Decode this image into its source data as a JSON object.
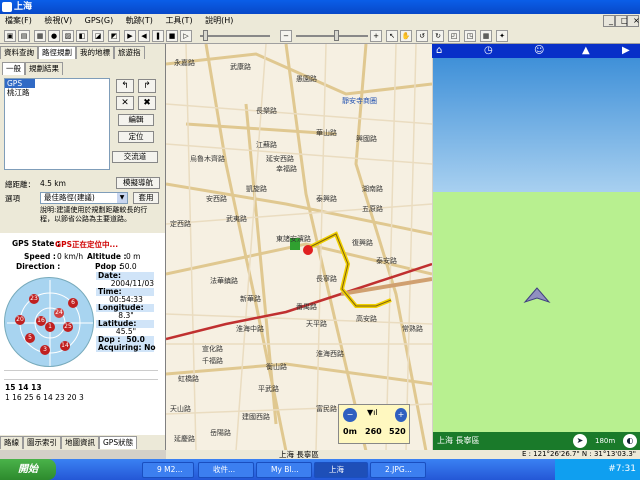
{
  "window": {
    "title": "上海"
  },
  "menu": [
    "檔案(F)",
    "檢視(V)",
    "GPS(G)",
    "軌跡(T)",
    "工具(T)",
    "說明(H)"
  ],
  "left_tabs": [
    "資料查詢",
    "路徑規劃",
    "我的地標",
    "旅遊指"
  ],
  "sub_tabs": [
    "一般",
    "規劃結果"
  ],
  "route_list": [
    "GPS",
    "桃江路"
  ],
  "buttons": {
    "edit": "編輯",
    "locate": "定位",
    "swap": "交流道",
    "simulate": "模擬導航",
    "apply": "套用"
  },
  "route_info": {
    "distance_label": "總距離：",
    "distance_value": "4.5 km",
    "option_label": "選項",
    "option_value": "最佳路徑(建議)"
  },
  "note": "說明:建議使用於規劃距離較長的行程，以節省公路為主要道路。",
  "gps": {
    "state_label": "GPS State :",
    "state_value": "GPS正在定位中...",
    "speed_label": "Speed :",
    "speed_value": "0 km/h",
    "altitude_label": "Altitude :",
    "altitude_value": "0 m",
    "direction_label": "Direction :",
    "pdop_label": "Pdop :",
    "pdop_value": "50.0",
    "date_label": "Date:",
    "date_value": "2004/11/03",
    "time_label": "Time:",
    "time_value": "00:54:33",
    "lon_label": "Longitude:",
    "lon_value": "8.3\"",
    "lat_label": "Latitude:",
    "lat_value": "45.5\"",
    "dop_label": "Dop :",
    "dop_value": "50.0",
    "acq_label": "Acquiring: No"
  },
  "satellites": [
    "23",
    "6",
    "20",
    "16",
    "24",
    "25",
    "1",
    "3",
    "14",
    "5"
  ],
  "snr_row1": "15 14 13",
  "snr_row2": "1 16 25 6 14 23 20 3",
  "bottom_tabs": [
    "路線",
    "圖示索引",
    "地圖資訊",
    "GPS狀態"
  ],
  "map_labels": {
    "l1": "永嘉路",
    "l2": "武康路",
    "l3": "靜安寺商圈",
    "l4": "愚園路",
    "l5": "長樂路",
    "l6": "延安西路",
    "l7": "東諸安濱路",
    "l8": "安西路",
    "l9": "定西路",
    "l10": "武夷路",
    "l11": "法華鎮路",
    "l12": "新華路",
    "l13": "番禺路",
    "l14": "淮海西路",
    "l15": "平武路",
    "l16": "虹橋路",
    "l17": "天山路",
    "l18": "宣化路",
    "l19": "千福路",
    "l20": "長寧路",
    "l21": "江蘇路",
    "l22": "華山路",
    "l23": "幸福路",
    "l24": "凱旋路",
    "l25": "興國路",
    "l26": "湖南路",
    "l27": "五原路",
    "l28": "復興路",
    "l29": "泰安路",
    "l30": "天平路",
    "l31": "淮海中路",
    "l32": "高安路",
    "l33": "烏魯木齊路",
    "l34": "衡山路",
    "l35": "建國西路",
    "l36": "岳陽路",
    "l37": "延慶路",
    "l38": "富民路",
    "l39": "常熟路",
    "l40": "泰興路"
  },
  "zoom": {
    "a": "0m",
    "b": "260",
    "c": "520"
  },
  "map_status": "上海 長寧區",
  "view3d_status": "上海 長寧區",
  "scale_label": "180m",
  "coords": "E : 121°26'26.7\"  N : 31°13'03.3\"",
  "taskbar": {
    "start": "開始",
    "tasks": [
      "9 M2...",
      "收件...",
      "My Bl...",
      "上海",
      "2.JPG..."
    ],
    "tray": "#7:31"
  },
  "colors": {
    "titlebar": "#0a5ee8",
    "route": "#f0d000",
    "road_major": "#d0a070",
    "road_express": "#c03030",
    "sky": "#5aa0e0",
    "ground": "#b8f090"
  }
}
